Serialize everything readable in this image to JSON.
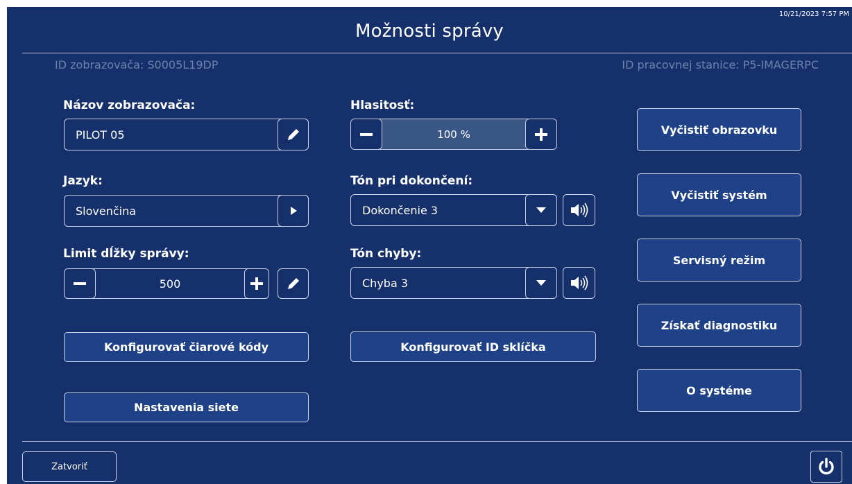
{
  "header": {
    "title": "Možnosti správy",
    "datetime": "10/21/2023 7:57 PM"
  },
  "ids": {
    "viewer_id": "ID zobrazovača: S0005L19DP",
    "workstation_id": "ID pracovnej stanice: P5-IMAGERPC"
  },
  "viewer_name": {
    "label": "Názov zobrazovača:",
    "value": "PILOT 05"
  },
  "language": {
    "label": "Jazyk:",
    "value": "Slovenčina"
  },
  "message_limit": {
    "label": "Limit dĺžky správy:",
    "value": "500"
  },
  "volume": {
    "label": "Hlasitosť:",
    "value": "100 %",
    "level_percent": 100
  },
  "completion_tone": {
    "label": "Tón pri dokončení:",
    "value": "Dokončenie 3"
  },
  "error_tone": {
    "label": "Tón chyby:",
    "value": "Chyba 3"
  },
  "buttons": {
    "configure_barcodes": "Konfigurovať čiarové kódy",
    "network_settings": "Nastavenia siete",
    "configure_slide_id": "Konfigurovať ID sklíčka",
    "clear_screen": "Vyčistiť obrazovku",
    "clear_system": "Vyčistiť systém",
    "service_mode": "Servisný režim",
    "get_diagnostics": "Získať diagnostiku",
    "about_system": "O systéme",
    "close": "Zatvoriť"
  },
  "icons": {
    "edit": "pencil-icon",
    "next": "play-arrow-icon",
    "dropdown": "caret-down-icon",
    "sound": "speaker-icon",
    "minus": "minus-icon",
    "plus": "plus-icon",
    "power": "power-icon"
  },
  "colors": {
    "background": "#15306a",
    "button": "#1e4187",
    "volume_fill": "#3a5687",
    "id_text": "#6f82ad"
  }
}
